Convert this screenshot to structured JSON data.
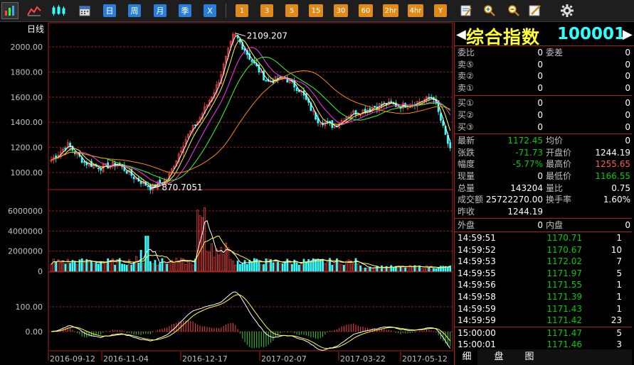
{
  "toolbar": {
    "period_buttons": [
      "日",
      "周",
      "月",
      "季",
      "X"
    ],
    "minute_buttons": [
      "1",
      "3",
      "5",
      "15",
      "30",
      "60",
      "2hr",
      "4hr",
      "Y"
    ]
  },
  "chart": {
    "period_label": "日线",
    "price_ticks": [
      "2000.00",
      "1800.00",
      "1600.00",
      "1400.00",
      "1200.00",
      "1000.00"
    ],
    "volume_ticks": [
      "6000000",
      "4000000",
      "2000000",
      "0"
    ],
    "macd_ticks": [
      "100.00",
      "0.00"
    ],
    "date_ticks": [
      "2016-09-12",
      "2016-11-04",
      "2016-12-17",
      "2017-02-07",
      "2017-03-22",
      "2017-05-12"
    ],
    "high_label": "2109.207",
    "low_label": "870.7051",
    "colors": {
      "up": "#ff4444",
      "down": "#33ffff",
      "grid": "#8b1a1a",
      "ma5": "#ffffff",
      "ma10": "#ffff33",
      "ma20": "#ff33ff",
      "ma30": "#33ff33",
      "ma60": "#ff8800"
    }
  },
  "chart_data": {
    "type": "line",
    "title": "",
    "x": [
      "2016-09-12",
      "2016-11-04",
      "2016-12-17",
      "2017-02-07",
      "2017-03-22",
      "2017-05-12"
    ],
    "series": [
      {
        "values": [
          1100,
          1220,
          1080,
          1040,
          1070,
          960,
          880,
          950,
          1250,
          1450,
          1700,
          2109,
          1900,
          1720,
          1760,
          1650,
          1420,
          1370,
          1470,
          1500,
          1550,
          1530,
          1560,
          1600,
          1172
        ]
      }
    ],
    "ylim": [
      800,
      2200
    ]
  },
  "quote": {
    "name": "综合指数",
    "code": "100001",
    "rows_a": [
      {
        "label": "委比",
        "val": "0",
        "label2": "委差",
        "val2": "0"
      },
      {
        "label": "卖⑤",
        "val": "0",
        "val2": "0"
      },
      {
        "label": "卖②",
        "val": "0",
        "val2": "0"
      },
      {
        "label": "卖①",
        "val": "0",
        "val2": "0"
      }
    ],
    "rows_b": [
      {
        "label": "买①",
        "val": "0",
        "val2": "0"
      },
      {
        "label": "买②",
        "val": "0",
        "val2": "0"
      },
      {
        "label": "买③",
        "val": "0",
        "val2": "0"
      }
    ],
    "stats": [
      {
        "label": "最新",
        "val": "1172.45",
        "label2": "均价",
        "val2": "0"
      },
      {
        "label": "张跌",
        "val": "-71.73",
        "label2": "开盘价",
        "val2": "1244.19"
      },
      {
        "label": "幅度",
        "val": "-5.77%",
        "label2": "最高价",
        "val2": "1255.65"
      },
      {
        "label": "现量",
        "val": "0",
        "label2": "最低价",
        "val2": "1166.55"
      },
      {
        "label": "总量",
        "val": "143204",
        "label2": "量比",
        "val2": "0.75"
      },
      {
        "label": "成交额",
        "val": "25722270.00",
        "label2": "换手率",
        "val2": "1.60%"
      },
      {
        "label": "昨收",
        "val": "1244.19",
        "label2": "",
        "val2": ""
      }
    ],
    "outer": {
      "label": "外盘",
      "val": "0",
      "label2": "内盘",
      "val2": "0"
    },
    "ticks": [
      {
        "t": "14:59:51",
        "p": "1170.71",
        "v": "1"
      },
      {
        "t": "14:59:52",
        "p": "1170.67",
        "v": "10"
      },
      {
        "t": "14:59:53",
        "p": "1172.02",
        "v": "7"
      },
      {
        "t": "14:59:55",
        "p": "1171.97",
        "v": "5"
      },
      {
        "t": "14:59:56",
        "p": "1171.55",
        "v": "1"
      },
      {
        "t": "14:59:58",
        "p": "1171.39",
        "v": "1"
      },
      {
        "t": "14:59:59",
        "p": "1171.43",
        "v": "1"
      },
      {
        "t": "14:59:59",
        "p": "1171.42",
        "v": "23"
      },
      {
        "t": "15:00:00",
        "p": "1171.47",
        "v": "5"
      },
      {
        "t": "15:00:01",
        "p": "1171.46",
        "v": "3"
      }
    ],
    "tabs": [
      "细",
      "盘",
      "图"
    ]
  }
}
